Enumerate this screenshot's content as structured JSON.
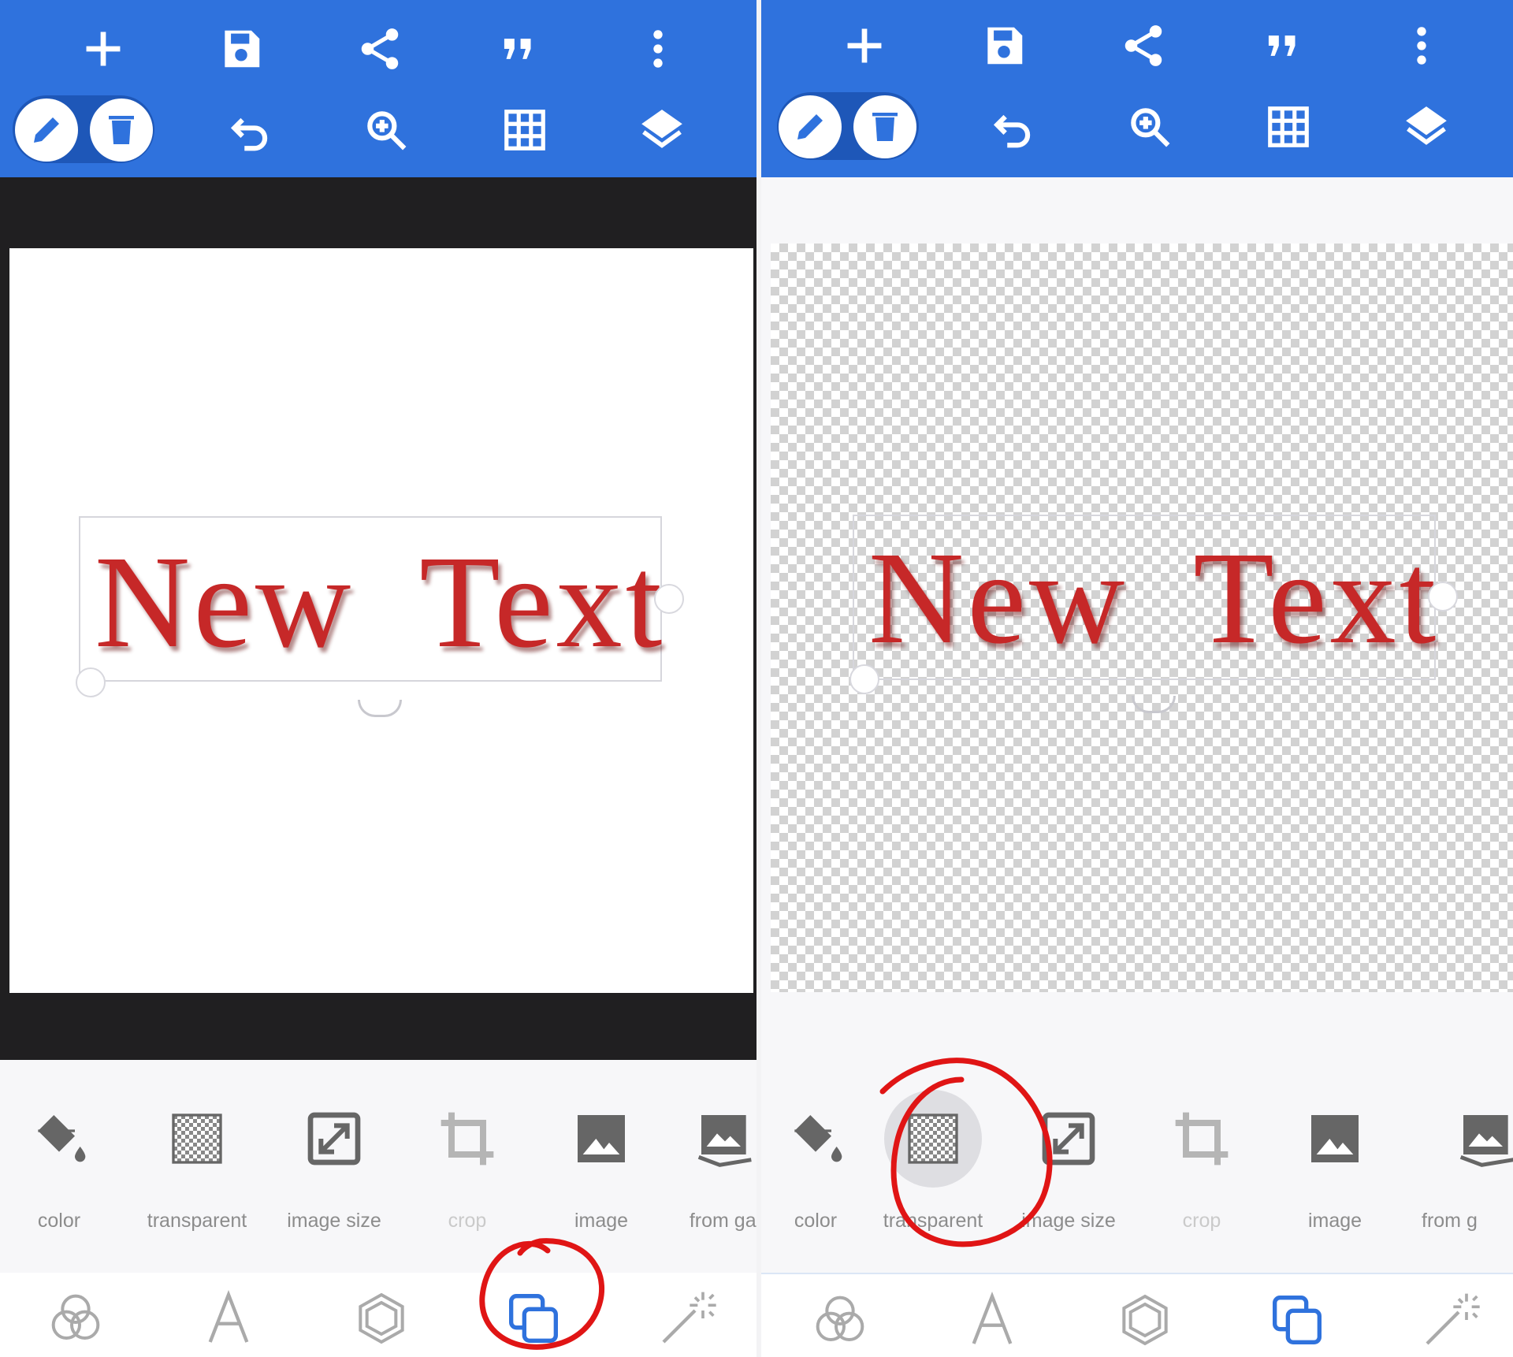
{
  "toolbar": {
    "top_icons": [
      "plus-icon",
      "save-icon",
      "share-icon",
      "quote-icon",
      "more-vert-icon"
    ],
    "bottom_icons": [
      "pencil-icon",
      "trash-icon",
      "undo-icon",
      "zoom-in-icon",
      "grid-icon",
      "layers-icon"
    ]
  },
  "canvas": {
    "text": "New Text",
    "text_color": "#c62828"
  },
  "tools": [
    {
      "label": "color",
      "icon": "paint-bucket-icon"
    },
    {
      "label": "transparent",
      "icon": "checkerboard-icon"
    },
    {
      "label": "image size",
      "icon": "resize-icon"
    },
    {
      "label": "crop",
      "icon": "crop-icon"
    },
    {
      "label": "image",
      "icon": "image-icon"
    },
    {
      "label": "from gal",
      "icon": "gallery-icon"
    }
  ],
  "tools_right_clipped_label": "from g",
  "bottom_nav": [
    "color-circles-icon",
    "text-icon",
    "shape-icon",
    "layers-copy-icon",
    "magic-wand-icon"
  ],
  "colors": {
    "toolbar": "#2f72dd",
    "accent": "#2f72dd",
    "annotation": "#e01515",
    "dark_background": "#201f21"
  }
}
